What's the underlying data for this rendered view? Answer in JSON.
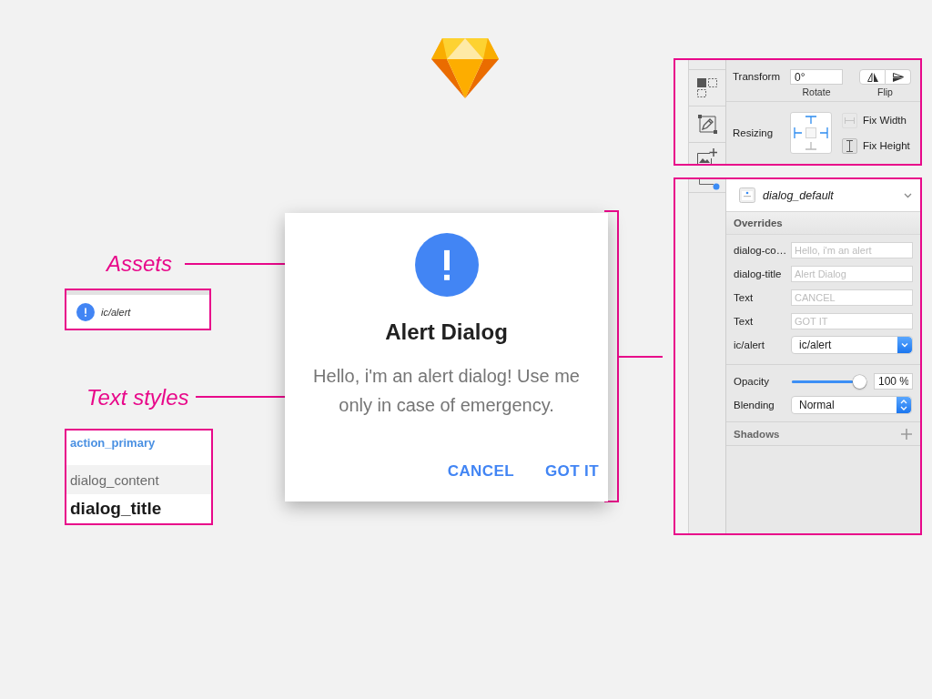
{
  "annotations": [
    {
      "label": "Assets"
    },
    {
      "label": "Text styles"
    }
  ],
  "assets": {
    "items": [
      {
        "name": "ic/alert"
      }
    ]
  },
  "text_styles": {
    "items": [
      {
        "name": "action_primary",
        "kind": "action"
      },
      {
        "name": "dialog_content",
        "kind": "content"
      },
      {
        "name": "dialog_title",
        "kind": "title"
      }
    ]
  },
  "dialog": {
    "title": "Alert Dialog",
    "message": "Hello, i'm an alert dialog! Use me only in case of emergency.",
    "buttons": [
      "CANCEL",
      "GOT IT"
    ]
  },
  "inspector": {
    "transform": {
      "label": "Transform",
      "rotate": {
        "value": "0°",
        "caption": "Rotate"
      },
      "flip": {
        "caption": "Flip"
      }
    },
    "resizing": {
      "label": "Resizing",
      "pins": {
        "top": true,
        "right": true,
        "bottom": false,
        "left": true
      },
      "options": [
        {
          "label": "Fix Width",
          "disabled": true
        },
        {
          "label": "Fix Height",
          "disabled": false
        }
      ]
    }
  },
  "symbol_inspector": {
    "symbol": {
      "name": "dialog_default"
    },
    "overrides": {
      "title": "Overrides",
      "rows": [
        {
          "kind": "text",
          "label": "dialog-co…",
          "placeholder": "Hello, i'm an alert"
        },
        {
          "kind": "text",
          "label": "dialog-title",
          "placeholder": "Alert Dialog"
        },
        {
          "kind": "text",
          "label": "Text",
          "placeholder": "CANCEL"
        },
        {
          "kind": "text",
          "label": "Text",
          "placeholder": "GOT IT"
        },
        {
          "kind": "select",
          "label": "ic/alert",
          "value": "ic/alert"
        }
      ]
    },
    "opacity": {
      "label": "Opacity",
      "level": 1,
      "reading": "100 %"
    },
    "blending": {
      "label": "Blending",
      "value": "Normal"
    },
    "shadows": {
      "title": "Shadows"
    }
  }
}
